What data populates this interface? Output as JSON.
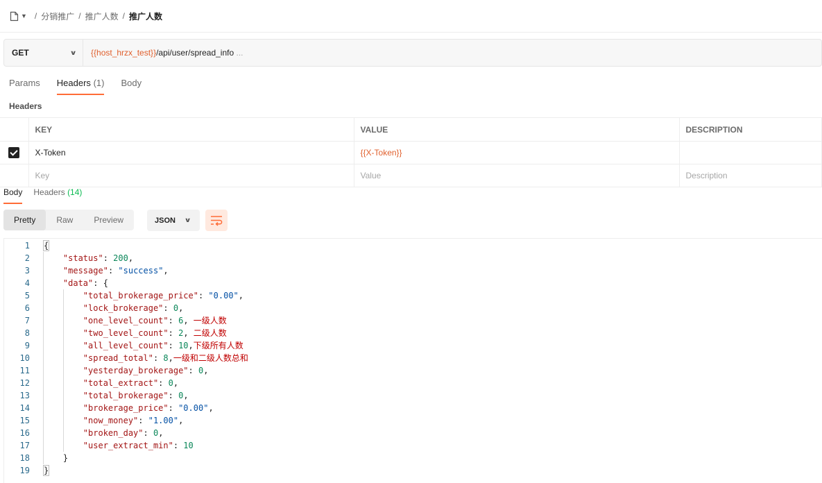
{
  "breadcrumb": {
    "icon": "document-icon",
    "items": [
      "分销推广",
      "推广人数",
      "推广人数"
    ]
  },
  "request": {
    "method": "GET",
    "url_variable": "{{host_hrzx_test}}",
    "url_path": "/api/user/spread_info",
    "url_ellipsis": "..."
  },
  "request_tabs": [
    {
      "label": "Params",
      "count": ""
    },
    {
      "label": "Headers",
      "count": "(1)"
    },
    {
      "label": "Body",
      "count": ""
    }
  ],
  "headers_section": {
    "title": "Headers",
    "columns": [
      "KEY",
      "VALUE",
      "DESCRIPTION"
    ],
    "rows": [
      {
        "checked": true,
        "key": "X-Token",
        "value": "{{X-Token}}",
        "description": ""
      }
    ],
    "placeholder": {
      "key": "Key",
      "value": "Value",
      "description": "Description"
    }
  },
  "response_tabs": [
    {
      "label": "Body",
      "count": ""
    },
    {
      "label": "Headers",
      "count": "(14)"
    }
  ],
  "view_modes": [
    "Pretty",
    "Raw",
    "Preview"
  ],
  "active_view": "Pretty",
  "format": "JSON",
  "code": {
    "line_numbers": [
      "1",
      "2",
      "3",
      "4",
      "5",
      "6",
      "7",
      "8",
      "9",
      "10",
      "11",
      "12",
      "13",
      "14",
      "15",
      "16",
      "17",
      "18",
      "19"
    ],
    "open_brace": "{",
    "close_brace": "}",
    "data_close": "}",
    "status_key": "\"status\"",
    "status_val": "200",
    "message_key": "\"message\"",
    "message_val": "\"success\"",
    "data_key": "\"data\"",
    "fields": [
      {
        "key": "\"total_brokerage_price\"",
        "val": "\"0.00\"",
        "type": "str",
        "comma": ",",
        "note": ""
      },
      {
        "key": "\"lock_brokerage\"",
        "val": "0",
        "type": "num",
        "comma": ",",
        "note": ""
      },
      {
        "key": "\"one_level_count\"",
        "val": "6",
        "type": "num",
        "comma": ", ",
        "note": "一级人数"
      },
      {
        "key": "\"two_level_count\"",
        "val": "2",
        "type": "num",
        "comma": ", ",
        "note": "二级人数"
      },
      {
        "key": "\"all_level_count\"",
        "val": "10",
        "type": "num",
        "comma": ",",
        "note": "下级所有人数"
      },
      {
        "key": "\"spread_total\"",
        "val": "8",
        "type": "num",
        "comma": ",",
        "note": "一级和二级人数总和"
      },
      {
        "key": "\"yesterday_brokerage\"",
        "val": "0",
        "type": "num",
        "comma": ",",
        "note": ""
      },
      {
        "key": "\"total_extract\"",
        "val": "0",
        "type": "num",
        "comma": ",",
        "note": ""
      },
      {
        "key": "\"total_brokerage\"",
        "val": "0",
        "type": "num",
        "comma": ",",
        "note": ""
      },
      {
        "key": "\"brokerage_price\"",
        "val": "\"0.00\"",
        "type": "str",
        "comma": ",",
        "note": ""
      },
      {
        "key": "\"now_money\"",
        "val": "\"1.00\"",
        "type": "str",
        "comma": ",",
        "note": ""
      },
      {
        "key": "\"broken_day\"",
        "val": "0",
        "type": "num",
        "comma": ",",
        "note": ""
      },
      {
        "key": "\"user_extract_min\"",
        "val": "10",
        "type": "num",
        "comma": "",
        "note": ""
      }
    ]
  },
  "colors": {
    "accent": "#ff6c37",
    "variable": "#e05f2c",
    "count_green": "#0cbb52",
    "json_key": "#a31515",
    "json_string": "#0451a5",
    "json_number": "#098658",
    "note": "#c00000"
  }
}
